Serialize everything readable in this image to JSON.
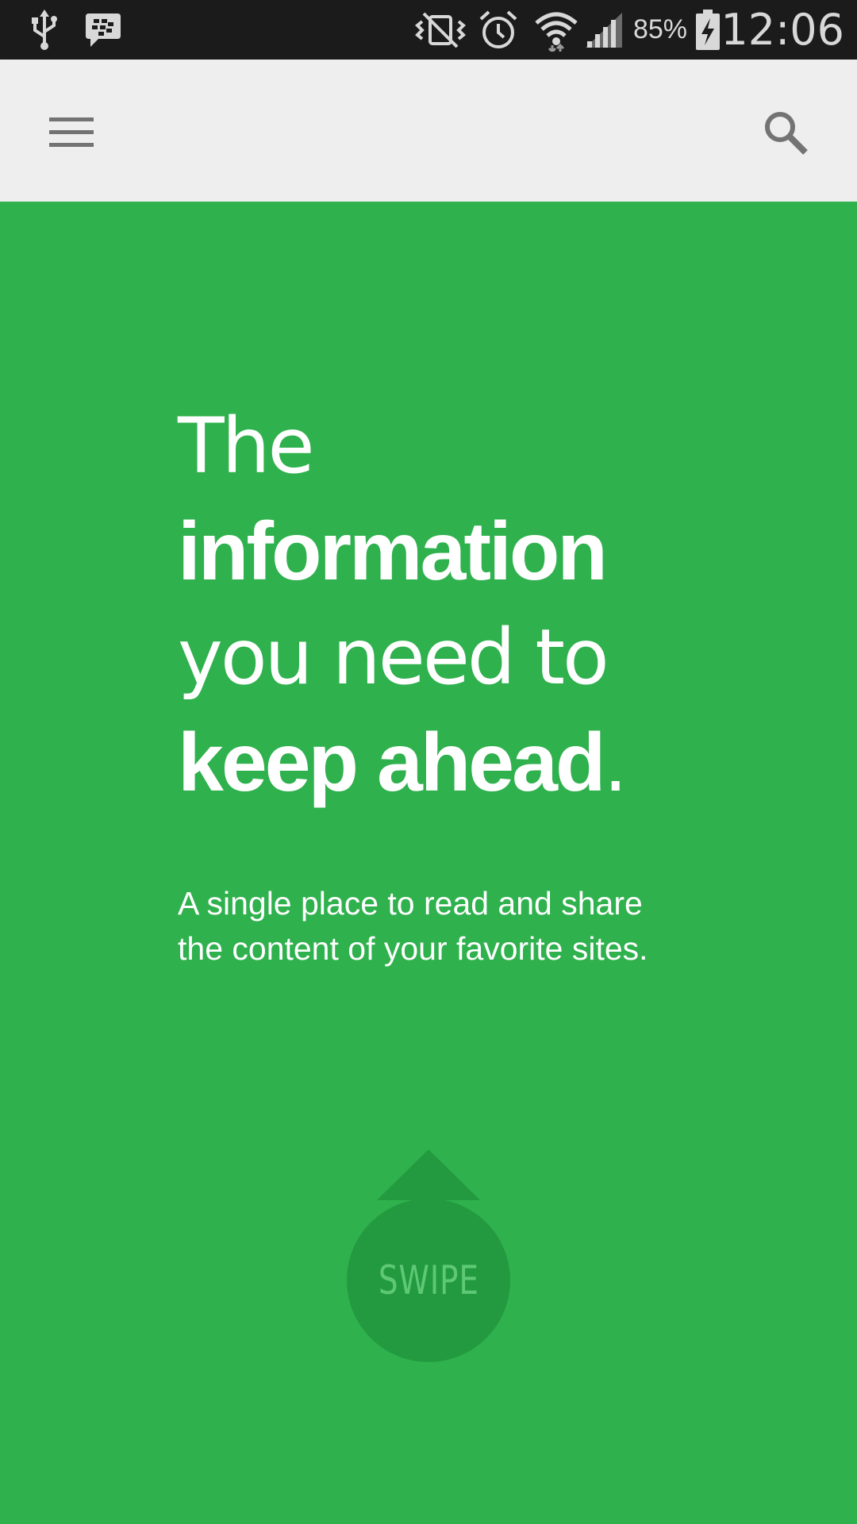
{
  "status_bar": {
    "left_icons": [
      "usb-icon",
      "bbm-icon"
    ],
    "right_icons": [
      "vibrate-off-icon",
      "alarm-icon",
      "wifi-icon",
      "signal-icon",
      "battery-charging-icon"
    ],
    "battery_percent": "85%",
    "time": "12:06"
  },
  "app_bar": {
    "menu_icon": "hamburger-menu-icon",
    "search_icon": "search-icon",
    "background": "#eeeeee"
  },
  "hero": {
    "background": "#2fb14d",
    "headline": {
      "line1": "The",
      "line2": "information",
      "line3": "you need to",
      "line4_bold": "keep ahead",
      "line4_end": "."
    },
    "subtitle": {
      "line1": "A single place to read and share",
      "line2": "the content of your favorite sites."
    },
    "swipe": {
      "label": "SWIPE",
      "color": "#239a3f"
    }
  }
}
